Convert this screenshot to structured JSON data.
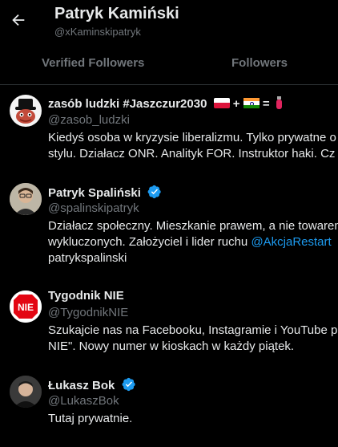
{
  "header": {
    "title": "Patryk Kamiński",
    "handle": "@xKaminskipatryk"
  },
  "tabs": [
    "Verified Followers",
    "Followers"
  ],
  "followers": [
    {
      "name": "zasób ludzki #Jaszczur2030",
      "name_suffix": [
        "+",
        "="
      ],
      "handle": "@zasob_ludzki",
      "bio": [
        "Kiedyś osoba w kryzysie liberalizmu. Tylko prywatne o",
        "stylu. Działacz ONR. Analityk FOR. Instruktor haki. Cz"
      ],
      "verified": false
    },
    {
      "name": "Patryk Spaliński",
      "handle": "@spalinskipatryk",
      "bio_line1": "Działacz społeczny. Mieszkanie prawem, a nie towarem",
      "bio_line2_text": "wykluczonych. Założyciel i lider ruchu ",
      "bio_line2_link": "@AkcjaRestart",
      "bio_line3": "patrykspalinski",
      "verified": true
    },
    {
      "name": "Tygodnik NIE",
      "handle": "@TygodnikNIE",
      "avatar_text": "NIE",
      "bio": [
        "Szukajcie nas na Facebooku, Instagramie i YouTube p",
        "NIE\". Nowy numer w kioskach w każdy piątek."
      ],
      "verified": false
    },
    {
      "name": "Łukasz Bok",
      "handle": "@LukaszBok",
      "bio": [
        "Tutaj prywatnie."
      ],
      "verified": true
    }
  ],
  "colors": {
    "background": "#000000",
    "text": "#e7e9ea",
    "secondary": "#71767b",
    "accent": "#1d9bf0",
    "divider": "#2f3336"
  }
}
